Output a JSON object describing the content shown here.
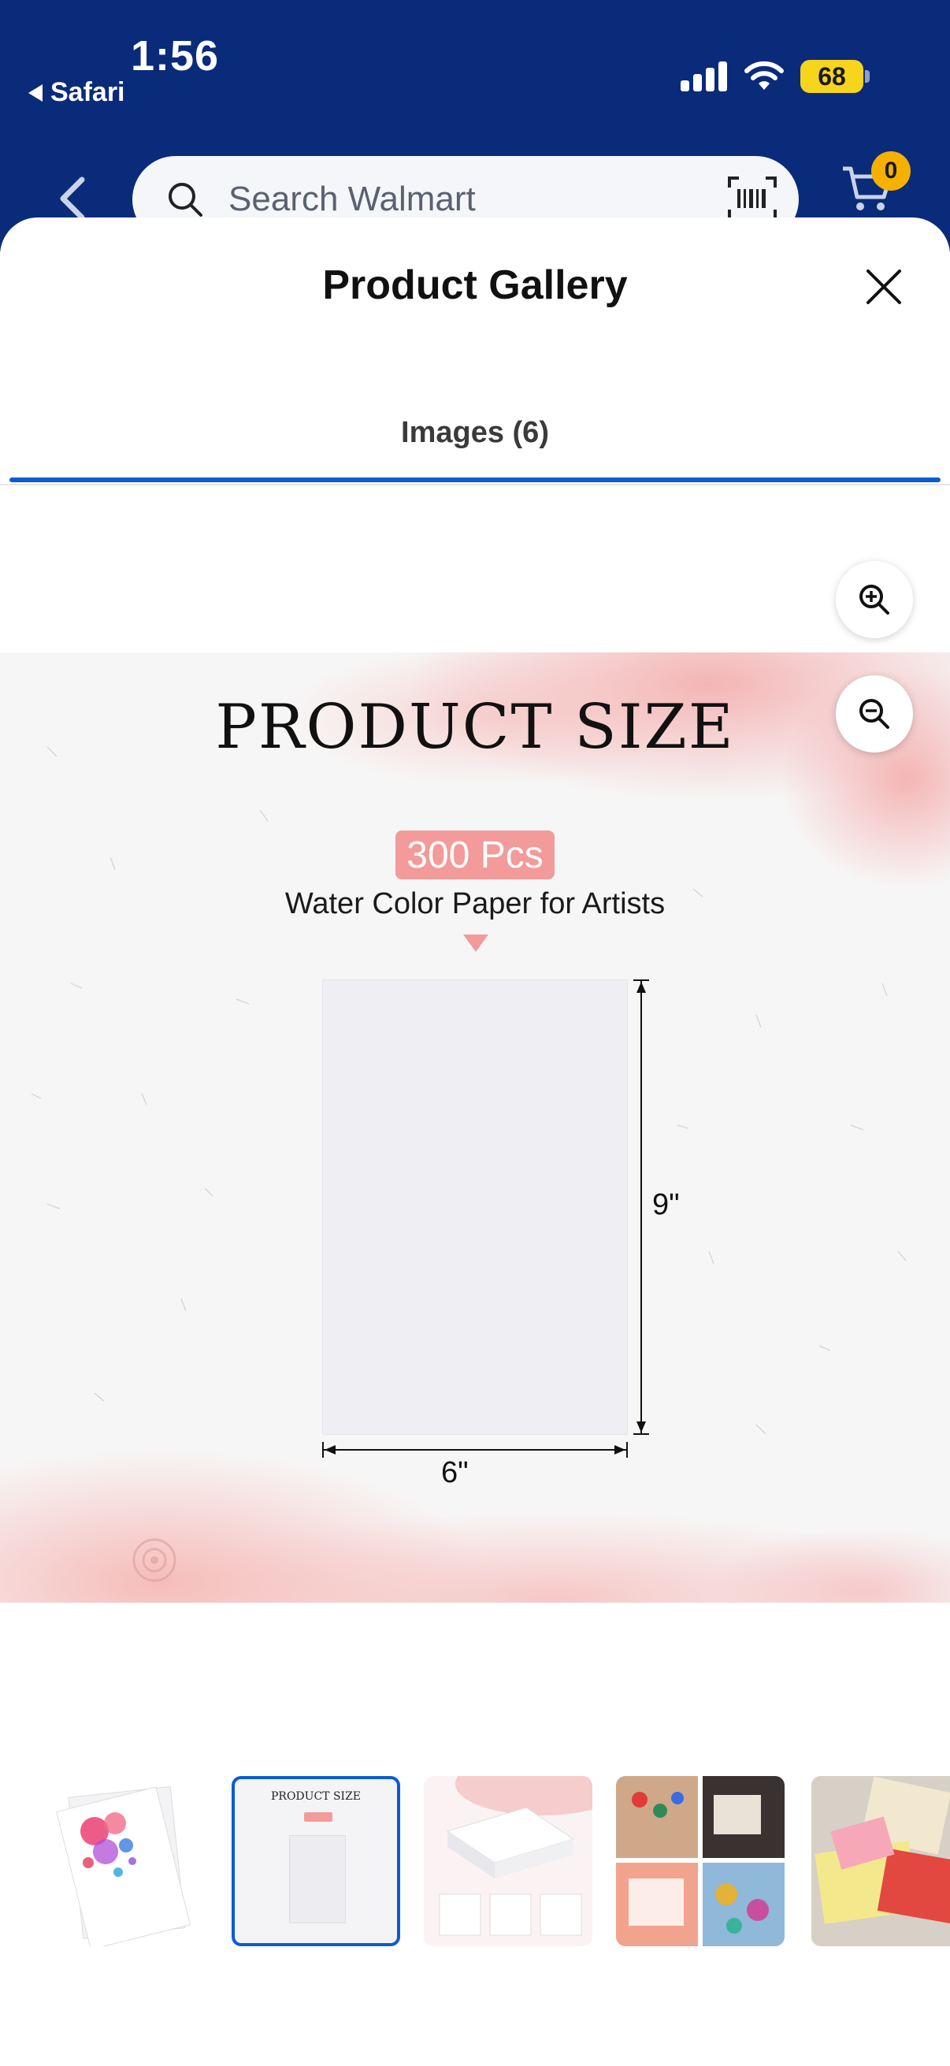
{
  "status_bar": {
    "time": "1:56",
    "back_app": "Safari",
    "battery": "68"
  },
  "header": {
    "search_placeholder": "Search Walmart",
    "cart_count": "0"
  },
  "sheet": {
    "title": "Product Gallery",
    "tab_label": "Images (6)"
  },
  "image": {
    "heading": "PRODUCT SIZE",
    "badge": "300 Pcs",
    "caption": "Water Color Paper for Artists",
    "width_label": "6\"",
    "height_label": "9\""
  },
  "thumbnails": {
    "count": 5,
    "selected_index": 1,
    "mini_title": "PRODUCT SIZE"
  },
  "colors": {
    "header_bg": "#0a2b7a",
    "accent_blue": "#0b5bd6",
    "badge_pink": "#f39a9a",
    "cart_badge": "#f5b000",
    "battery": "#f7d51d"
  }
}
